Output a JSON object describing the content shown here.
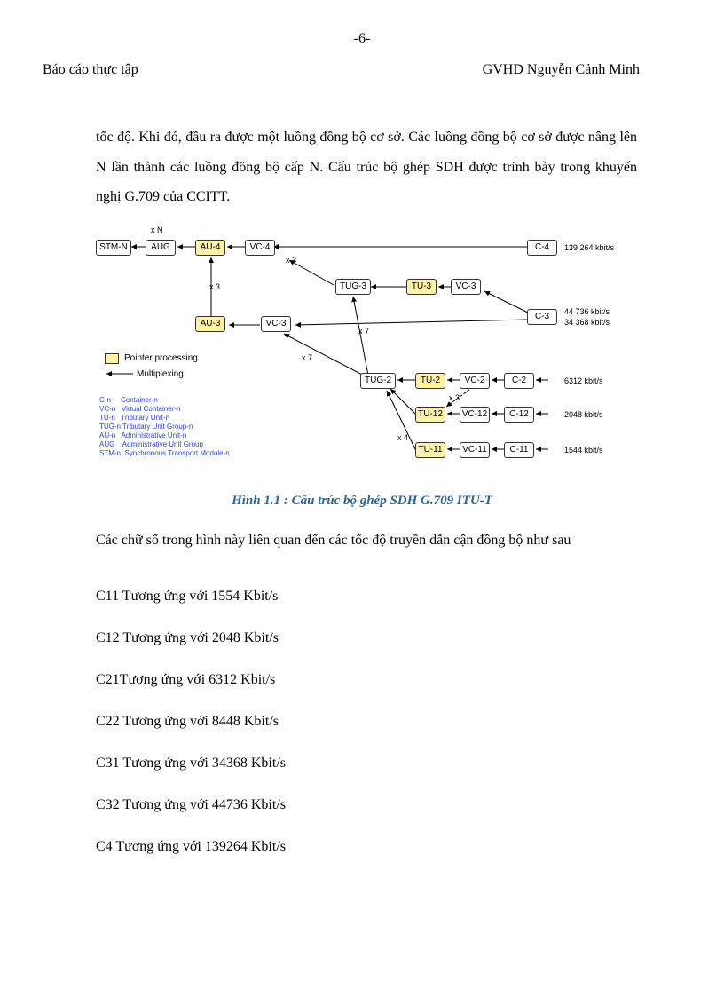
{
  "pageNumber": "-6-",
  "headerLeft": "Báo cáo thực tập",
  "headerRight": "GVHD Nguyễn Cảnh Minh",
  "para1": "tốc độ.  Khi đó, đầu ra được một luồng đồng bộ cơ sở. Các luồng đồng bộ cơ sở được nâng lên N lần thành các luồng đồng bộ cấp N. Cấu trúc bộ ghép SDH được trình bày trong khuyến nghị  G.709 của CCITT.",
  "figureCaption": "Hình  1.1 : Cấu trúc bộ ghép SDH G.709 ITU-T",
  "para2Indent": "     Các chữ số trong hình này liên quan đến các tốc độ truyền dẫn cận đồng bộ như sau",
  "lines": {
    "c11": "C11 Tương ứng với 1554 Kbit/s",
    "c12": "C12 Tương ứng với 2048 Kbit/s",
    "c21": "C21Tương ứng với 6312 Kbit/s",
    "c22": "C22 Tương ứng với 8448 Kbit/s",
    "c31": "C31 Tương ứng với 34368 Kbit/s",
    "c32": "C32 Tương ứng với 44736 Kbit/s",
    "c4": "C4 Tương ứng với 139264 Kbit/s"
  },
  "diagram": {
    "xN": "x N",
    "stmN": "STM-N",
    "aug": "AUG",
    "au4": "AU-4",
    "vc4": "VC-4",
    "au3": "AU-3",
    "vc3a": "VC-3",
    "tug3": "TUG-3",
    "tu3": "TU-3",
    "vc3b": "VC-3",
    "c4": "C-4",
    "c3": "C-3",
    "tug2": "TUG-2",
    "tu2": "TU-2",
    "vc2": "VC-2",
    "c2": "C-2",
    "tu12": "TU-12",
    "vc12": "VC-12",
    "c12": "C-12",
    "tu11": "TU-11",
    "vc11": "VC-11",
    "c11": "C-11",
    "x3a": "x 3",
    "x3b": "x 3",
    "x3c": "x 3",
    "x7a": "x 7",
    "x7b": "x 7",
    "x4": "x 4",
    "rate_c4": "139 264 kbit/s",
    "rate_c3a": "44 736 kbit/s",
    "rate_c3b": "34 368 kbit/s",
    "rate_c2": "6312 kbit/s",
    "rate_c12": "2048 kbit/s",
    "rate_c11": "1544 kbit/s",
    "legend_pointer": "Pointer processing",
    "legend_mux": "Multiplexing",
    "glossary": {
      "cn": "C-n     Container-n",
      "vcn": "VC-n   Virtual Container-n",
      "tun": "TU-n   Tributary Unit-n",
      "tugn": "TUG-n Tributary Unit Group-n",
      "aun": "AU-n   Administrative Unit-n",
      "aug": "AUG    Administrative Unit Group",
      "stmn": "STM-n  Synchronous Transport Module-n"
    }
  }
}
